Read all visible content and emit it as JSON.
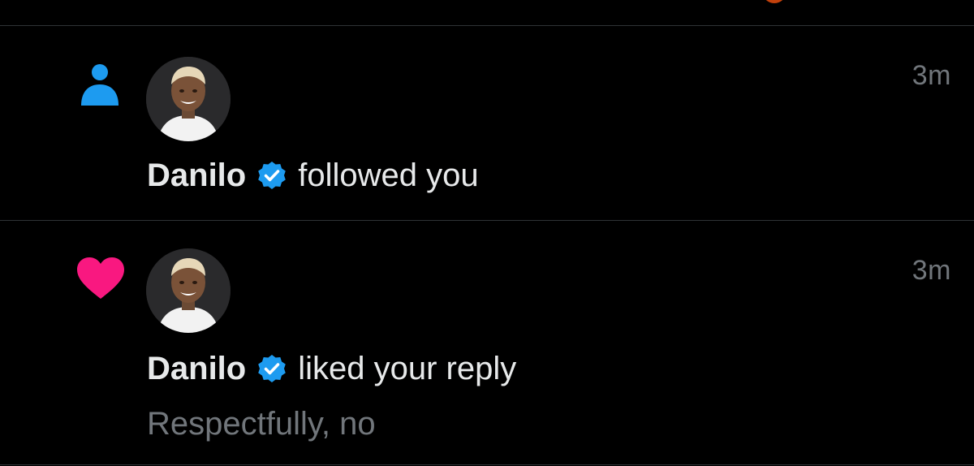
{
  "colors": {
    "background": "#000000",
    "divider": "#2f3336",
    "primary_text": "#e7e9ea",
    "secondary_text": "#71767b",
    "follow_icon": "#1d9bf0",
    "like_icon": "#f91880",
    "verified_badge": "#1d9bf0"
  },
  "notifications": [
    {
      "type_icon": "person-follow-icon",
      "avatar_user": "Danilo",
      "name": "Danilo",
      "verified": true,
      "action": "followed you",
      "timestamp": "3m",
      "quote": ""
    },
    {
      "type_icon": "heart-like-icon",
      "avatar_user": "Danilo",
      "name": "Danilo",
      "verified": true,
      "action": "liked your reply",
      "timestamp": "3m",
      "quote": "Respectfully, no"
    }
  ]
}
